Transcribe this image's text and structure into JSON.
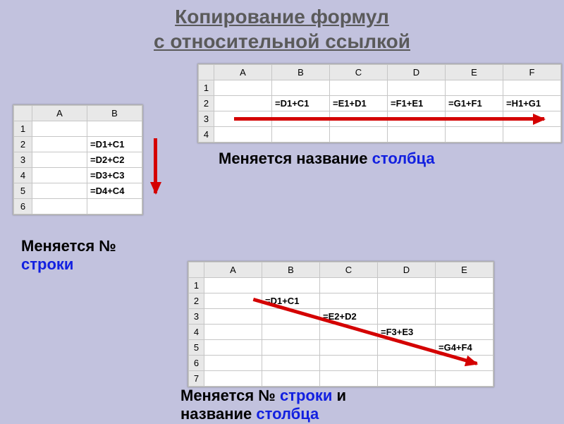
{
  "title_line1": "Копирование формул",
  "title_line2": "с относительной ссылкой",
  "sheet1": {
    "cols": [
      "A",
      "B"
    ],
    "rows": [
      "1",
      "2",
      "3",
      "4",
      "5",
      "6"
    ],
    "cells": {
      "B2": "=D1+C1",
      "B3": "=D2+C2",
      "B4": "=D3+C3",
      "B5": "=D4+C4"
    }
  },
  "sheet2": {
    "cols": [
      "A",
      "B",
      "C",
      "D",
      "E",
      "F"
    ],
    "rows": [
      "1",
      "2",
      "3",
      "4"
    ],
    "cells": {
      "B2": "=D1+C1",
      "C2": "=E1+D1",
      "D2": "=F1+E1",
      "E2": "=G1+F1",
      "F2": "=H1+G1"
    }
  },
  "sheet3": {
    "cols": [
      "A",
      "B",
      "C",
      "D",
      "E"
    ],
    "rows": [
      "1",
      "2",
      "3",
      "4",
      "5",
      "6",
      "7"
    ],
    "cells": {
      "B2": "=D1+C1",
      "C3": "=E2+D2",
      "D4": "=F3+E3",
      "E5": "=G4+F4"
    }
  },
  "caption1_a": "Меняется № ",
  "caption1_b": "строки",
  "caption2_a": "Меняется название ",
  "caption2_b": "столбца",
  "caption3_a": "Меняется № ",
  "caption3_b": "строки",
  "caption3_c": " и",
  "caption3_d": "название",
  "caption3_e": " столбца"
}
